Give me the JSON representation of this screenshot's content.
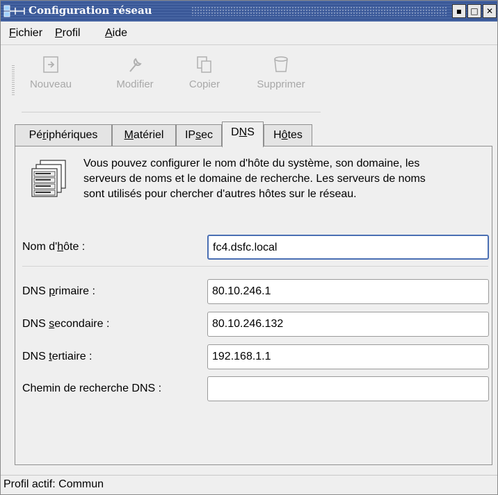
{
  "window": {
    "title": "Configuration réseau",
    "buttons": {
      "minimize": "▪",
      "maximize": "□",
      "close": "✕"
    }
  },
  "menu": [
    {
      "accel": "F",
      "rest": "ichier"
    },
    {
      "accel": "P",
      "rest": "rofil"
    },
    {
      "accel": "A",
      "rest": "ide"
    }
  ],
  "toolbar": {
    "new": "Nouveau",
    "edit": "Modifier",
    "copy": "Copier",
    "delete": "Supprimer"
  },
  "tabs": [
    {
      "pre": "Pé",
      "accel": "r",
      "post": "iphériques"
    },
    {
      "pre": "",
      "accel": "M",
      "post": "atériel"
    },
    {
      "pre": "IP",
      "accel": "s",
      "post": "ec"
    },
    {
      "pre": "D",
      "accel": "N",
      "post": "S"
    },
    {
      "pre": "H",
      "accel": "ô",
      "post": "tes"
    }
  ],
  "active_tab": "DNS",
  "description": "Vous pouvez configurer le nom d'hôte du système, son domaine, les serveurs de noms et le domaine de recherche. Les serveurs de noms sont utilisés pour chercher d'autres hôtes sur le réseau.",
  "form": {
    "hostname": {
      "pre": "Nom d'",
      "accel": "h",
      "post": "ôte :",
      "value": "fc4.dsfc.local"
    },
    "dns1": {
      "pre": "DNS ",
      "accel": "p",
      "post": "rimaire :",
      "value": "80.10.246.1"
    },
    "dns2": {
      "pre": "DNS ",
      "accel": "s",
      "post": "econdaire :",
      "value": "80.10.246.132"
    },
    "dns3": {
      "pre": "DNS ",
      "accel": "t",
      "post": "ertiaire :",
      "value": "192.168.1.1"
    },
    "search": {
      "label": "Chemin de recherche DNS :",
      "value": ""
    }
  },
  "status": "Profil actif: Commun",
  "colors": {
    "titlebar": "#3a5a9c",
    "window_bg": "#efefef",
    "focus_border": "#4a6fb3"
  }
}
